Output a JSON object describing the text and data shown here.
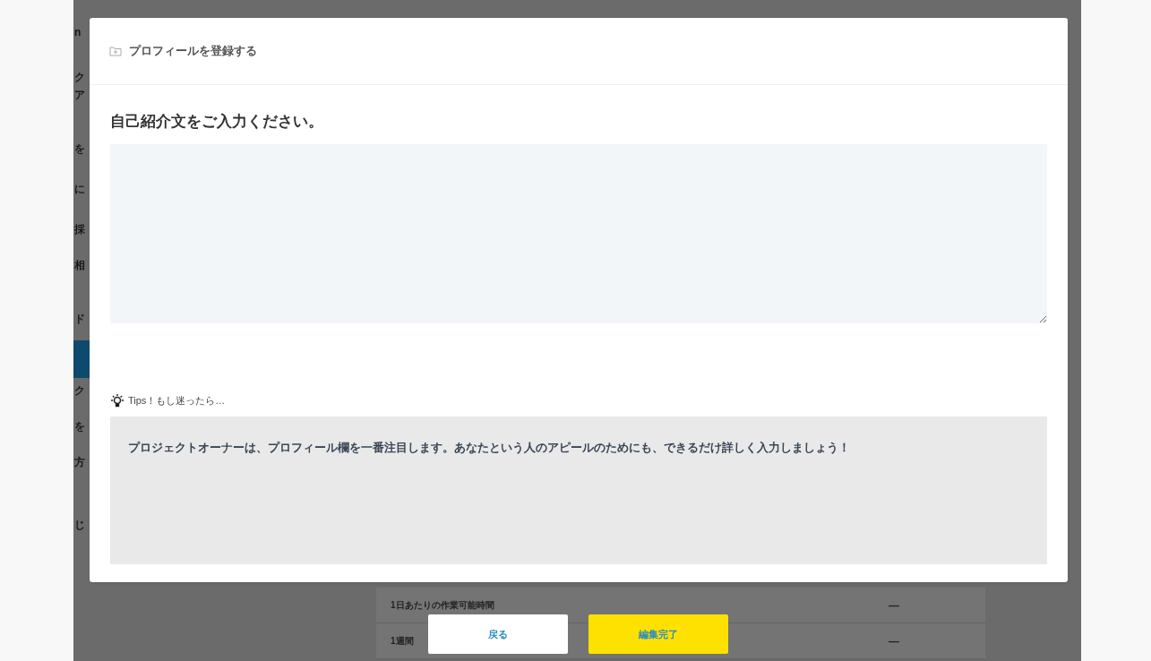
{
  "background_sidebar": [
    "n",
    "ク",
    "ア",
    "を",
    "に",
    "採",
    "相",
    "ド",
    "ク",
    "を",
    "方",
    "じ"
  ],
  "background_table": [
    {
      "label": "1日あたりの作業可能時間",
      "value": "—"
    },
    {
      "label": "1週間",
      "value": "—"
    }
  ],
  "modal": {
    "title": "プロフィールを登録する",
    "heading": "自己紹介文をご入力ください。",
    "tips_title": "Tips！もし迷ったら…",
    "tips_text": "プロジェクトオーナーは、プロフィール欄を一番注目します。あなたという人のアピールのためにも、できるだけ詳しく入力しましょう！"
  },
  "buttons": [
    {
      "label": "戻る",
      "kind": "secondary"
    },
    {
      "label": "編集完了",
      "kind": "primary"
    }
  ]
}
